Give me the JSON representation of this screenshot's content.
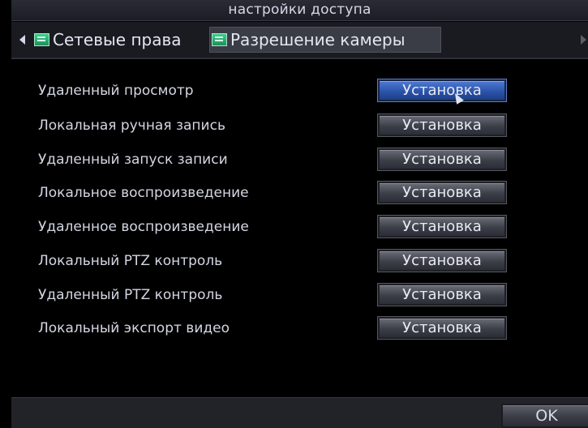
{
  "window": {
    "title": "настройки доступа"
  },
  "tabs": [
    {
      "label": "Сетевые права",
      "icon": "network-icon",
      "active": false
    },
    {
      "label": "Разрешение камеры",
      "icon": "camera-permission-icon",
      "active": true
    }
  ],
  "permissions": [
    {
      "label": "Удаленный просмотр",
      "button": "Установка",
      "selected": true
    },
    {
      "label": "Локальная ручная запись",
      "button": "Установка",
      "selected": false
    },
    {
      "label": "Удаленный запуск записи",
      "button": "Установка",
      "selected": false
    },
    {
      "label": "Локальное воспроизведение",
      "button": "Установка",
      "selected": false
    },
    {
      "label": "Удаленное воспроизведение",
      "button": "Установка",
      "selected": false
    },
    {
      "label": "Локальный PTZ контроль",
      "button": "Установка",
      "selected": false
    },
    {
      "label": "Удаленный PTZ контроль",
      "button": "Установка",
      "selected": false
    },
    {
      "label": "Локальный экспорт видео",
      "button": "Установка",
      "selected": false
    }
  ],
  "footer": {
    "ok_label": "OK"
  },
  "colors": {
    "background": "#000000",
    "selected_button": "#2c54aa",
    "button": "#3c3e48",
    "text": "#d4d6e2"
  }
}
